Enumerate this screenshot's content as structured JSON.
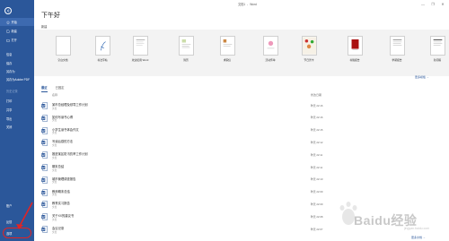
{
  "window": {
    "doc_name": "文档1",
    "app_name": "Word",
    "sep": "-",
    "minimize": "—",
    "restore": "❐",
    "close": "✕"
  },
  "sidebar": {
    "back_icon": "arrow-left-icon",
    "items": [
      {
        "label": "开始",
        "icon": "home-icon",
        "active": true
      },
      {
        "label": "新建",
        "icon": "new-doc-icon"
      },
      {
        "label": "打开",
        "icon": "folder-icon"
      },
      {
        "label": "信息"
      },
      {
        "label": "保存"
      },
      {
        "label": "另存为"
      },
      {
        "label": "另存为Adobe PDF"
      },
      {
        "label": "历史记录",
        "dim": true
      },
      {
        "label": "打印"
      },
      {
        "label": "共享"
      },
      {
        "label": "导出"
      },
      {
        "label": "关闭"
      },
      {
        "label": "账户"
      },
      {
        "label": "反馈"
      },
      {
        "label": "选项"
      }
    ]
  },
  "greeting": "下午好",
  "new_section_label": "新建",
  "templates": [
    {
      "label": "空白文档"
    },
    {
      "label": "书法字帖"
    },
    {
      "label": "欢迎使用 Word"
    },
    {
      "label": "简历"
    },
    {
      "label": "求职信"
    },
    {
      "label": "活动传单"
    },
    {
      "label": "节日贺卡"
    },
    {
      "label": "书籍报告"
    },
    {
      "label": "学期报告"
    },
    {
      "label": "新闻稿"
    }
  ],
  "more_templates": "更多模板 →",
  "tabs": [
    {
      "label": "最近",
      "active": true
    },
    {
      "label": "已固定"
    }
  ],
  "columns": {
    "name": "名称",
    "modified": "修改日期"
  },
  "files": [
    {
      "name": "某市总经理及领导工作计划",
      "path": "文档",
      "date": "昨天 22:16"
    },
    {
      "name": "如何写读书心得",
      "path": "文档",
      "date": "昨天 22:16"
    },
    {
      "name": "小学生读书体会作文",
      "path": "文档",
      "date": "昨天 22:15"
    },
    {
      "name": "写读后感的方法",
      "path": "文档",
      "date": "昨天 22:12"
    },
    {
      "name": "推进某区防汛抗旱工作计划",
      "path": "文档",
      "date": "昨天 22:11"
    },
    {
      "name": "期末总结",
      "path": "文档",
      "date": "昨天 22:11"
    },
    {
      "name": "城市管理调查报告",
      "path": "文档",
      "date": "昨天 22:10"
    },
    {
      "name": "教师期末总结",
      "path": "文档",
      "date": "昨天 22:09"
    },
    {
      "name": "教育实习报告",
      "path": "文档",
      "date": "昨天 22:09"
    },
    {
      "name": "关于XX的建议书",
      "path": "文档",
      "date": "昨天 22:08"
    },
    {
      "name": "会议记录",
      "path": "文档",
      "date": "昨天 22:07"
    }
  ],
  "more_documents": "更多文档 →",
  "watermark": {
    "brand": "Baidu经验",
    "site": "jingyan.baidu.com"
  },
  "colors": {
    "sidebar": "#2b579a",
    "accent": "#2b579a",
    "annotation": "#e02424"
  }
}
